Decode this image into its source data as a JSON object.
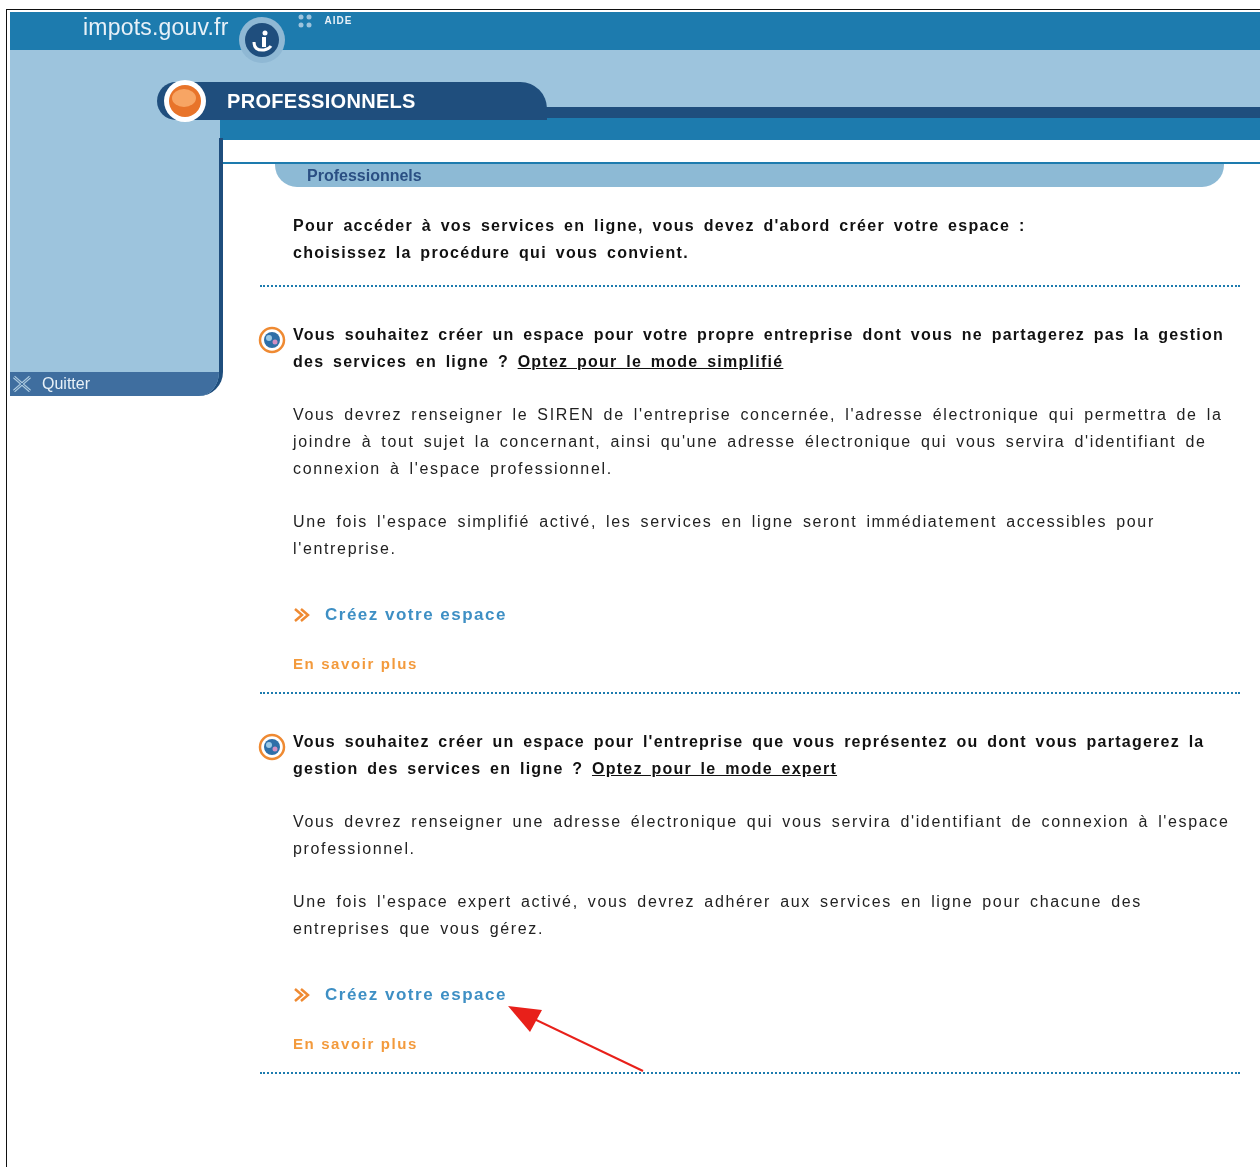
{
  "header": {
    "logo": "impots.gouv.fr",
    "help_link": "AIDE",
    "section_tab": "PROFESSIONNELS"
  },
  "sidebar": {
    "items": [
      {
        "label": "Quitter"
      }
    ]
  },
  "breadcrumb": "Professionnels",
  "intro": [
    "Pour accéder à vos services en ligne, vous devez d'abord créer votre espace :",
    "choisissez la procédure qui vous convient."
  ],
  "sections": [
    {
      "question": "Vous souhaitez créer un espace pour votre propre entreprise dont vous ne partagerez pas la gestion des services en ligne ?",
      "mode_link": "Optez pour le mode simplifié",
      "paragraphs": [
        "Vous devrez renseigner le SIREN de l'entreprise concernée, l'adresse électronique qui permettra de la joindre à tout sujet la concernant, ainsi qu'une adresse électronique qui vous servira d'identifiant de connexion à l'espace professionnel.",
        "Une fois l'espace simplifié activé, les services en ligne seront immédiatement accessibles pour l'entreprise."
      ],
      "create_link": "Créez votre espace",
      "more_link": "En savoir plus"
    },
    {
      "question": "Vous souhaitez créer un espace pour l'entreprise que vous représentez ou dont vous partagerez la gestion des services en ligne ?",
      "mode_link": "Optez pour le mode expert",
      "paragraphs": [
        "Vous devrez renseigner une adresse électronique qui vous servira d'identifiant de connexion à l'espace professionnel.",
        "Une fois l'espace expert activé, vous devrez adhérer aux services en ligne pour chacune des entreprises que vous gérez."
      ],
      "create_link": "Créez votre espace",
      "more_link": "En savoir plus"
    }
  ]
}
